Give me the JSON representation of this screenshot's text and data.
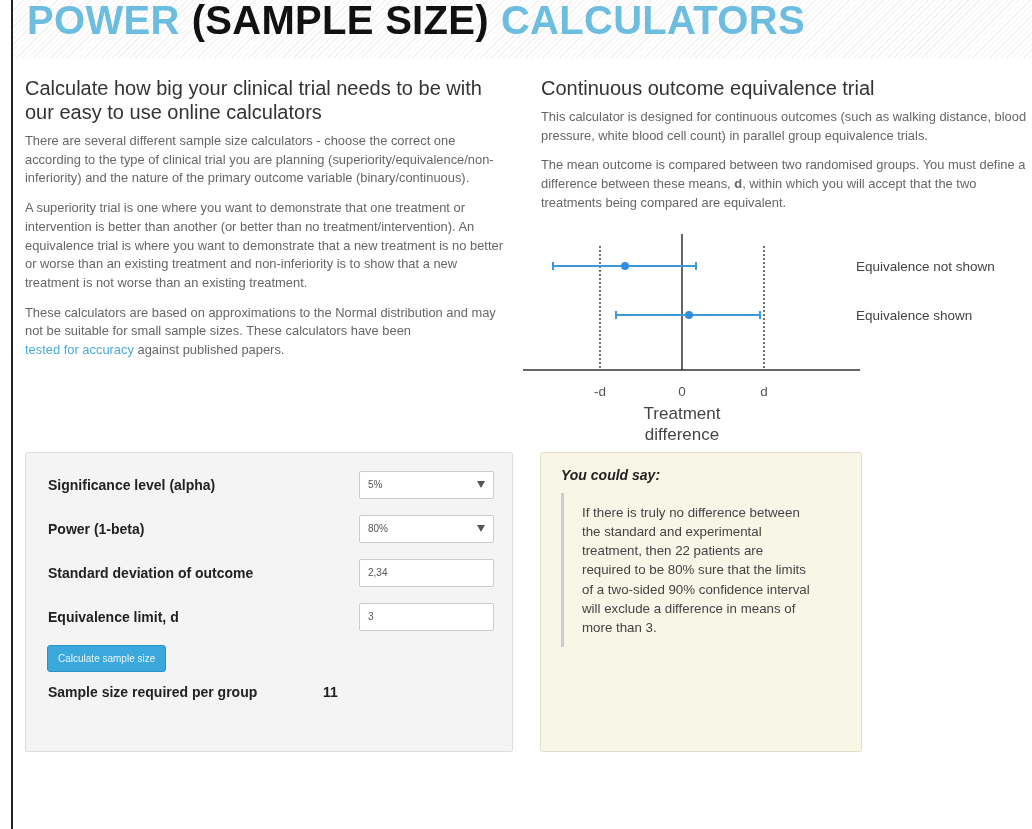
{
  "title": {
    "parts": [
      {
        "text": "POWER",
        "accent": true
      },
      {
        "text": "(SAMPLE SIZE)",
        "accent": false
      },
      {
        "text": "CALCULATORS",
        "accent": true
      }
    ]
  },
  "left": {
    "heading": "Calculate how big your clinical trial needs to be with our easy to use online calculators",
    "paragraphs": [
      {
        "text": "There are several different sample size calculators - choose the correct one according to the type of clinical trial you are planning (superiority/equivalence/non-inferiority) and the nature of the primary outcome variable (binary/continuous)."
      },
      {
        "text": "A superiority trial is one where you want to demonstrate that one treatment or intervention is better than another (or better than no treatment/intervention). An equivalence trial is where you want to demonstrate that a new treatment is no better or worse than an existing treatment and non-inferiority is to show that a new treatment is not worse than an existing treatment."
      },
      {
        "text": "These calculators are based on approximations to the Normal distribution and may not be suitable for small sample sizes. These calculators have been",
        "link": "tested for accuracy",
        "after": "against published papers."
      }
    ]
  },
  "right": {
    "heading": "Continuous outcome equivalence trial",
    "paragraphs": [
      "This calculator is designed for continuous outcomes (such as walking distance, blood pressure, white blood cell count) in parallel group equivalence trials.",
      "The mean outcome is compared between two randomised groups. You must define a difference between these means, **d**, within which you will accept that the two treatments being compared are equivalent."
    ],
    "diagram": {
      "rows": [
        "Equivalence not shown",
        "Equivalence shown"
      ],
      "ticks": [
        "-d",
        "0",
        "d"
      ],
      "axis_label": "Treatment difference"
    }
  },
  "form": {
    "fields": [
      {
        "label": "Significance level (alpha)",
        "kind": "select",
        "value": "5%"
      },
      {
        "label": "Power (1-beta)",
        "kind": "select",
        "value": "80%"
      },
      {
        "label": "Standard deviation of outcome",
        "kind": "input",
        "value": "2,34"
      },
      {
        "label": "Equivalence limit, d",
        "kind": "input",
        "value": "3"
      }
    ],
    "button": "Calculate sample size",
    "result": {
      "label": "Sample size required per group",
      "value": "11"
    }
  },
  "quote": {
    "heading": "You could say:",
    "text": "If there is truly no difference between the standard and experimental treatment, then 22 patients are required to be 80% sure that the limits of a two-sided 90% confidence interval will exclude a difference in means of more than 3."
  }
}
